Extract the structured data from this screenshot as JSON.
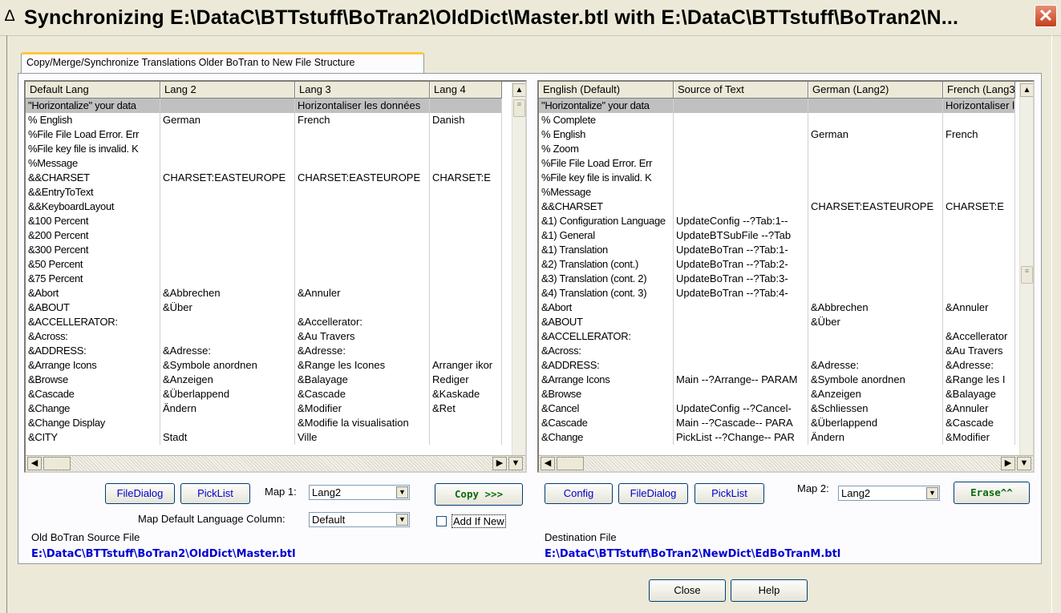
{
  "window": {
    "title": "Synchronizing E:\\DataC\\BTTstuff\\BoTran2\\OldDict\\Master.btl with E:\\DataC\\BTTstuff\\BoTran2\\N...",
    "title_icon": "delta-triangle-icon",
    "close_glyph": "✕"
  },
  "tab": {
    "label": "Copy/Merge/Synchronize Translations Older BoTran to New File Structure"
  },
  "left_grid": {
    "columns": [
      "Default Lang",
      "Lang 2",
      "Lang 3",
      "Lang 4"
    ],
    "rows": [
      [
        "\"Horizontalize\" your data",
        "",
        "Horizontaliser les données",
        ""
      ],
      [
        "% English",
        "German",
        "French",
        "Danish"
      ],
      [
        "%File File Load Error.  Err",
        "",
        "",
        ""
      ],
      [
        "%File key file is invalid. K",
        "",
        "",
        ""
      ],
      [
        "%Message",
        "",
        "",
        ""
      ],
      [
        "&&CHARSET",
        "CHARSET:EASTEUROPE",
        "CHARSET:EASTEUROPE",
        "CHARSET:E"
      ],
      [
        "&&EntryToText",
        "",
        "",
        ""
      ],
      [
        "&&KeyboardLayout",
        "",
        "",
        ""
      ],
      [
        "&100 Percent",
        "",
        "",
        ""
      ],
      [
        "&200 Percent",
        "",
        "",
        ""
      ],
      [
        "&300 Percent",
        "",
        "",
        ""
      ],
      [
        "&50 Percent",
        "",
        "",
        ""
      ],
      [
        "&75 Percent",
        "",
        "",
        ""
      ],
      [
        "&Abort",
        "&Abbrechen",
        "&Annuler",
        ""
      ],
      [
        "&ABOUT",
        "&Über",
        "",
        ""
      ],
      [
        "&ACCELLERATOR:",
        "",
        "&Accellerator:",
        ""
      ],
      [
        "&Across:",
        "",
        "&Au Travers",
        ""
      ],
      [
        "&ADDRESS:",
        "&Adresse:",
        "&Adresse:",
        ""
      ],
      [
        "&Arrange Icons",
        "&Symbole anordnen",
        "&Range les Icones",
        "Arranger ikor"
      ],
      [
        "&Browse",
        "&Anzeigen",
        "&Balayage",
        "Rediger"
      ],
      [
        "&Cascade",
        "&Überlappend",
        "&Cascade",
        "&Kaskade"
      ],
      [
        "&Change",
        "Ändern",
        "&Modifier",
        "&Ret"
      ],
      [
        "&Change Display",
        "",
        "&Modifie la visualisation",
        ""
      ],
      [
        "&CITY",
        "Stadt",
        "Ville",
        ""
      ]
    ]
  },
  "right_grid": {
    "columns": [
      "English (Default)",
      "Source of Text",
      "German (Lang2)",
      "French (Lang3)"
    ],
    "rows": [
      [
        "\"Horizontalize\" your data",
        "",
        "",
        "Horizontaliser les données"
      ],
      [
        "% Complete",
        "",
        "",
        ""
      ],
      [
        "% English",
        "",
        "German",
        "French"
      ],
      [
        "% Zoom",
        "",
        "",
        ""
      ],
      [
        "%File File Load Error.  Err",
        "",
        "",
        ""
      ],
      [
        "%File key file is invalid. K",
        "",
        "",
        ""
      ],
      [
        "%Message",
        "",
        "",
        ""
      ],
      [
        "&&CHARSET",
        "",
        "CHARSET:EASTEUROPE",
        "CHARSET:E"
      ],
      [
        "&1) Configuration Language",
        "UpdateConfig --?Tab:1--",
        "",
        ""
      ],
      [
        "&1) General",
        "UpdateBTSubFile --?Tab",
        "",
        ""
      ],
      [
        "&1) Translation",
        "UpdateBoTran --?Tab:1-",
        "",
        ""
      ],
      [
        "&2) Translation (cont.)",
        "UpdateBoTran --?Tab:2-",
        "",
        ""
      ],
      [
        "&3) Translation (cont. 2)",
        "UpdateBoTran --?Tab:3-",
        "",
        ""
      ],
      [
        "&4) Translation (cont. 3)",
        "UpdateBoTran --?Tab:4-",
        "",
        ""
      ],
      [
        "&Abort",
        "",
        "&Abbrechen",
        "&Annuler"
      ],
      [
        "&ABOUT",
        "",
        "&Über",
        ""
      ],
      [
        "&ACCELLERATOR:",
        "",
        "",
        "&Accellerator"
      ],
      [
        "&Across:",
        "",
        "",
        "&Au Travers"
      ],
      [
        "&ADDRESS:",
        "",
        "&Adresse:",
        "&Adresse:"
      ],
      [
        "&Arrange Icons",
        "Main --?Arrange-- PARAM",
        "&Symbole anordnen",
        "&Range les I"
      ],
      [
        "&Browse",
        "",
        "&Anzeigen",
        "&Balayage"
      ],
      [
        "&Cancel",
        "UpdateConfig --?Cancel-",
        "&Schliessen",
        "&Annuler"
      ],
      [
        "&Cascade",
        "Main --?Cascade-- PARA",
        "&Überlappend",
        "&Cascade"
      ],
      [
        "&Change",
        "PickList --?Change-- PAR",
        "Ändern",
        "&Modifier"
      ]
    ]
  },
  "left_controls": {
    "filedialog": "FileDialog",
    "picklist": "PickList",
    "map1_label": "Map 1:",
    "map1_value": "Lang2",
    "copy": "Copy >>>",
    "map_default_label": "Map Default Language Column:",
    "map_default_value": "Default",
    "add_if_new": "Add If New",
    "source_label": "Old BoTran Source File",
    "source_path": "E:\\DataC\\BTTstuff\\BoTran2\\OldDict\\Master.btl"
  },
  "right_controls": {
    "config": "Config",
    "filedialog": "FileDialog",
    "picklist": "PickList",
    "map2_label": "Map 2:",
    "map2_value": "Lang2",
    "erase": "Erase^^",
    "dest_label": "Destination File",
    "dest_path": "E:\\DataC\\BTTstuff\\BoTran2\\NewDict\\EdBoTranM.btl"
  },
  "footer": {
    "close": "Close",
    "help": "Help"
  },
  "colors": {
    "link_blue": "#0000d0",
    "action_green": "#0b6b0b",
    "selected_row": "#c0c0c0"
  }
}
